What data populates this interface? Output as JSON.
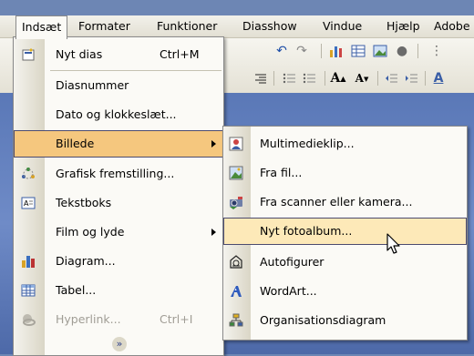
{
  "menubar": {
    "items": [
      {
        "label": "Indsæt",
        "active": true
      },
      {
        "label": "Formater"
      },
      {
        "label": "Funktioner"
      },
      {
        "label": "Diasshow"
      },
      {
        "label": "Vindue"
      },
      {
        "label": "Hjælp"
      },
      {
        "label": "Adobe"
      }
    ]
  },
  "insert_menu": {
    "items": [
      {
        "label": "Nyt dias",
        "shortcut": "Ctrl+M",
        "icon": "new-slide-icon"
      },
      {
        "label": "Diasnummer"
      },
      {
        "label": "Dato og klokkeslæt..."
      },
      {
        "label": "Billede",
        "submenu": true,
        "state": "open"
      },
      {
        "label": "Grafisk fremstilling...",
        "icon": "diagram-gallery-icon"
      },
      {
        "label": "Tekstboks",
        "icon": "textbox-icon"
      },
      {
        "label": "Film og lyde",
        "submenu": true
      },
      {
        "label": "Diagram...",
        "icon": "chart-icon"
      },
      {
        "label": "Tabel...",
        "icon": "table-icon"
      },
      {
        "label": "Hyperlink...",
        "shortcut": "Ctrl+I",
        "icon": "hyperlink-icon",
        "disabled": true
      }
    ],
    "expand_icon": "double-chevron-down-icon"
  },
  "picture_submenu": {
    "items": [
      {
        "label": "Multimedieklip...",
        "icon": "clip-art-icon"
      },
      {
        "label": "Fra fil...",
        "icon": "picture-from-file-icon"
      },
      {
        "label": "Fra scanner eller kamera...",
        "icon": "scanner-camera-icon"
      },
      {
        "label": "Nyt fotoalbum...",
        "state": "highlighted"
      },
      {
        "label": "Autofigurer",
        "icon": "autoshapes-icon"
      },
      {
        "label": "WordArt...",
        "icon": "wordart-icon"
      },
      {
        "label": "Organisationsdiagram",
        "icon": "org-chart-icon"
      }
    ]
  },
  "colors": {
    "menu_bg": "#fbfaf6",
    "highlight": "#f5c77e",
    "selection": "#fde9b8",
    "border": "#4b4b6f",
    "workspace": "#6d86b4"
  }
}
